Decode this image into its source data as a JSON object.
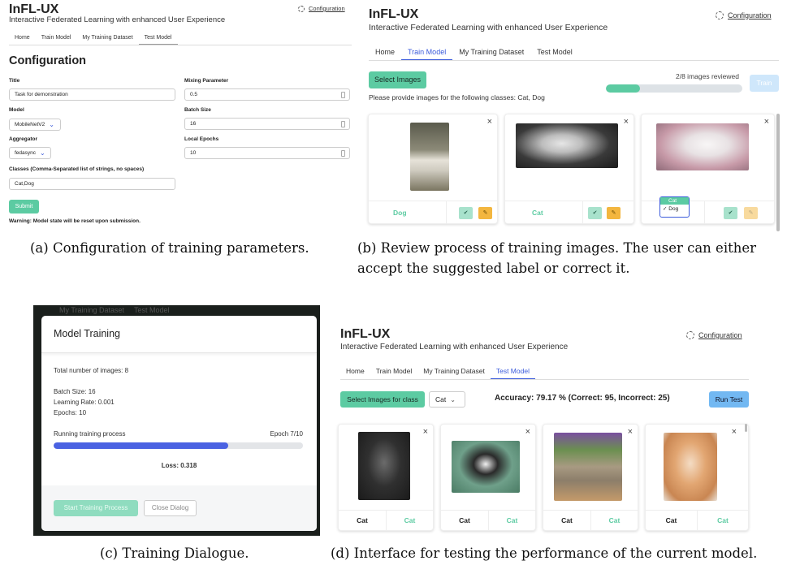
{
  "app": {
    "title": "InFL-UX",
    "subtitle": "Interactive Federated Learning with enhanced User Experience",
    "config_link": "Configuration"
  },
  "tabs": [
    "Home",
    "Train Model",
    "My Training Dataset",
    "Test Model"
  ],
  "panel_a": {
    "heading": "Configuration",
    "title_label": "Title",
    "title_value": "Task for demonstration",
    "mixing_label": "Mixing Parameter",
    "mixing_value": "0.5",
    "model_label": "Model",
    "model_value": "MobileNetV2",
    "batch_label": "Batch Size",
    "batch_value": "16",
    "aggregator_label": "Aggregator",
    "aggregator_value": "fedasync",
    "epochs_label": "Local Epochs",
    "epochs_value": "10",
    "classes_label": "Classes (Comma-Separated list of strings, no spaces)",
    "classes_value": "Cat,Dog",
    "submit": "Submit",
    "warning": "Warning: Model state will be reset upon submission.",
    "caption": "(a) Configuration of training parameters."
  },
  "panel_b": {
    "select_button": "Select Images",
    "reviewed": "2/8 images reviewed",
    "reviewed_fraction": 0.25,
    "train_button": "Train",
    "instruction": "Please provide images for the following classes: Cat, Dog",
    "cards": [
      {
        "label": "Dog",
        "photo": "dog-photo"
      },
      {
        "label": "Cat",
        "photo": "cat-photo"
      },
      {
        "label": "Cat",
        "photo": "cat-photo"
      }
    ],
    "dropdown": {
      "options": [
        "Cat",
        "Dog"
      ],
      "checked": "Dog"
    },
    "caption_line1": "(b) Review process of training images. The user can either",
    "caption_line2": "accept the suggested label or correct it."
  },
  "panel_c": {
    "bg_tab1": "My Training Dataset",
    "bg_tab2": "Test Model",
    "title": "Model Training",
    "total": "Total number of images: 8",
    "batch": "Batch Size: 16",
    "lr": "Learning Rate: 0.001",
    "epochs": "Epochs: 10",
    "running": "Running training process",
    "epoch_status": "Epoch 7/10",
    "progress_fraction": 0.7,
    "loss": "Loss: 0.318",
    "start_button": "Start Training Process",
    "close_button": "Close Dialog",
    "caption": "(c) Training Dialogue."
  },
  "panel_d": {
    "select_button": "Select Images for class",
    "class_value": "Cat",
    "accuracy": "Accuracy: 79.17 % (Correct: 95, Incorrect: 25)",
    "run_button": "Run Test",
    "cards": [
      {
        "true_label": "Cat",
        "pred_label": "Cat"
      },
      {
        "true_label": "Cat",
        "pred_label": "Cat"
      },
      {
        "true_label": "Cat",
        "pred_label": "Cat"
      },
      {
        "true_label": "Cat",
        "pred_label": "Cat"
      }
    ],
    "caption": "(d) Interface for testing the performance of the current model."
  },
  "colors": {
    "accent_green": "#5ccba2",
    "accent_blue": "#3b5bdb",
    "run_button_blue": "#72b8f2",
    "warning_orange": "#f3b63f"
  },
  "icons": [
    "gear-icon",
    "close-icon",
    "chevron-down-icon",
    "check-icon",
    "pencil-icon"
  ]
}
